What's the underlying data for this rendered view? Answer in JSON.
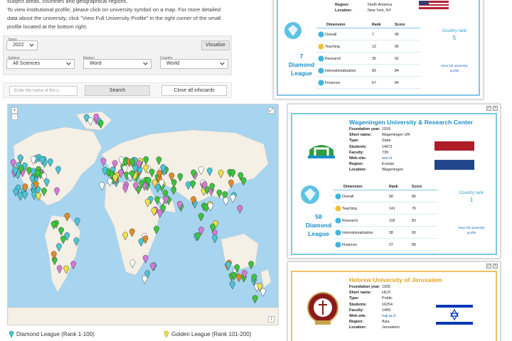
{
  "intro": {
    "line1": "subject areas, countries and geographical regions.",
    "line2": "To view institutional profile, please click on university symbol on a map. For more detailed",
    "line3": "data about the university, click \"View Full University Profile\" in the right corner of the small",
    "line4": "profile located at the bottom right."
  },
  "filters": {
    "year_label": "Years",
    "year_value": "2022",
    "visualize_label": "Visualize",
    "subject_label": "Subject",
    "subject_value": "All Sciences",
    "region_label": "Region",
    "region_value": "Word",
    "country_label": "Country",
    "country_value": "World"
  },
  "search": {
    "placeholder": "Enter the name of the u",
    "search_label": "Search",
    "close_label": "Close all infocards"
  },
  "map": {
    "zoom_in": "+",
    "zoom_out": "-",
    "fullscreen": "⤢",
    "info": "i",
    "colors": {
      "ocean": "#a7d4ee",
      "land": "#f4f0e6",
      "diamond": "#49c6d6",
      "golden": "#f0e04a",
      "green": "#3cc43c",
      "pink": "#d67ad6",
      "orange": "#e08a2a",
      "white": "#ffffff"
    }
  },
  "legend": {
    "diamond": "Diamond League (Rank 1-100)",
    "golden": "Golden League (Rank 101-200)"
  },
  "card1": {
    "region_key": "Region:",
    "region_val": "North America",
    "location_key": "Location:",
    "location_val": "New York, NY",
    "league_num": "7",
    "league_name": "Diamond",
    "league_word": "League",
    "table_head": [
      "Dimension",
      "Rank",
      "Score"
    ],
    "rows": [
      {
        "dim": "Overall",
        "rank": "7",
        "score": "96"
      },
      {
        "dim": "Teaching",
        "rank": "13",
        "score": "95"
      },
      {
        "dim": "Research",
        "rank": "35",
        "score": "92"
      },
      {
        "dim": "Internationalization",
        "rank": "83",
        "score": "84"
      },
      {
        "dim": "Finances",
        "rank": "67",
        "score": "84"
      }
    ],
    "country_rank_label": "Country rank",
    "country_rank_value": "5",
    "view_full_1": "View full university",
    "view_full_2": "profile"
  },
  "card2": {
    "name": "Wageningen University & Research Center",
    "info": [
      {
        "k": "Foundation year:",
        "v": "1918"
      },
      {
        "k": "Short name:",
        "v": "Wageningen UR"
      },
      {
        "k": "Type:",
        "v": "State"
      },
      {
        "k": "Students:",
        "v": "14671"
      },
      {
        "k": "Faculty:",
        "v": "739"
      },
      {
        "k": "Web-site:",
        "v": "wur.nl"
      },
      {
        "k": "Region:",
        "v": "Europe"
      },
      {
        "k": "Location:",
        "v": "Wageningen"
      }
    ],
    "league_num": "58",
    "league_name": "Diamond",
    "league_word": "League",
    "table_head": [
      "Dimension",
      "Rank",
      "Score"
    ],
    "rows": [
      {
        "dim": "Overall",
        "rank": "58",
        "score": "86"
      },
      {
        "dim": "Teaching",
        "rank": "141",
        "score": "76"
      },
      {
        "dim": "Research",
        "rank": "118",
        "score": "83"
      },
      {
        "dim": "Internationalization",
        "rank": "38",
        "score": "90"
      },
      {
        "dim": "Finances",
        "rank": "37",
        "score": "88"
      }
    ],
    "country_rank_label": "Country rank",
    "country_rank_value": "1",
    "view_full_1": "View full university",
    "view_full_2": "profile"
  },
  "card3": {
    "name": "Hebrew University of Jerusalem",
    "info": [
      {
        "k": "Foundation year:",
        "v": "1925"
      },
      {
        "k": "Short name:",
        "v": "HUJI"
      },
      {
        "k": "Type:",
        "v": "Public"
      },
      {
        "k": "Students:",
        "v": "16254"
      },
      {
        "k": "Faculty:",
        "v": "1409"
      },
      {
        "k": "Web-site:",
        "v": "huji.ac.il"
      },
      {
        "k": "Region:",
        "v": "Asia"
      },
      {
        "k": "Location:",
        "v": "Jerusalem"
      }
    ]
  },
  "card_controls": {
    "restore": "⤢",
    "close": "×"
  },
  "colors": {
    "teal_border": "#7ec7e6",
    "league_blue": "#1c8fc9",
    "wageningen_name": "#1c8fc9",
    "hebrew_name": "#e8a21a"
  }
}
